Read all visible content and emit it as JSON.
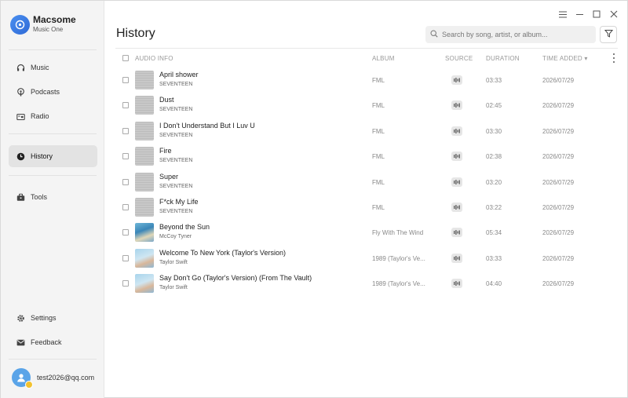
{
  "app": {
    "name": "Macsome",
    "subtitle": "Music One"
  },
  "sidebar": {
    "items": [
      {
        "label": "Music",
        "icon": "headphones-icon"
      },
      {
        "label": "Podcasts",
        "icon": "podcast-icon"
      },
      {
        "label": "Radio",
        "icon": "radio-icon"
      },
      {
        "label": "History",
        "icon": "clock-icon",
        "active": true
      },
      {
        "label": "Tools",
        "icon": "toolbox-icon"
      },
      {
        "label": "Settings",
        "icon": "gear-icon"
      },
      {
        "label": "Feedback",
        "icon": "mail-icon"
      }
    ],
    "user_email": "test2026@qq.com"
  },
  "header": {
    "title": "History",
    "search_placeholder": "Search by song, artist, or album..."
  },
  "table": {
    "columns": {
      "audio_info": "AUDIO INFO",
      "album": "ALBUM",
      "source": "SOURCE",
      "duration": "DURATION",
      "time_added": "TIME ADDED ▾"
    },
    "rows": [
      {
        "title": "April shower",
        "artist": "SEVENTEEN",
        "album": "FML",
        "duration": "03:33",
        "added": "2026/07/29",
        "cover": "fml"
      },
      {
        "title": "Dust",
        "artist": "SEVENTEEN",
        "album": "FML",
        "duration": "02:45",
        "added": "2026/07/29",
        "cover": "fml"
      },
      {
        "title": "I Don't Understand But I Luv U",
        "artist": "SEVENTEEN",
        "album": "FML",
        "duration": "03:30",
        "added": "2026/07/29",
        "cover": "fml"
      },
      {
        "title": "Fire",
        "artist": "SEVENTEEN",
        "album": "FML",
        "duration": "02:38",
        "added": "2026/07/29",
        "cover": "fml"
      },
      {
        "title": "Super",
        "artist": "SEVENTEEN",
        "album": "FML",
        "duration": "03:20",
        "added": "2026/07/29",
        "cover": "fml"
      },
      {
        "title": "F*ck My Life",
        "artist": "SEVENTEEN",
        "album": "FML",
        "duration": "03:22",
        "added": "2026/07/29",
        "cover": "fml"
      },
      {
        "title": "Beyond the Sun",
        "artist": "McCoy Tyner",
        "album": "Fly With The Wind",
        "duration": "05:34",
        "added": "2026/07/29",
        "cover": "wind"
      },
      {
        "title": "Welcome To New York (Taylor's Version)",
        "artist": "Taylor Swift",
        "album": "1989 (Taylor's Ve...",
        "duration": "03:33",
        "added": "2026/07/29",
        "cover": "ts"
      },
      {
        "title": "Say Don't Go (Taylor's Version) (From The Vault)",
        "artist": "Taylor Swift",
        "album": "1989 (Taylor's Ve...",
        "duration": "04:40",
        "added": "2026/07/29",
        "cover": "ts"
      }
    ]
  },
  "colors": {
    "accent": "#3a78e0",
    "sidebar_bg": "#f4f4f4",
    "active_item_bg": "#e3e3e3"
  }
}
